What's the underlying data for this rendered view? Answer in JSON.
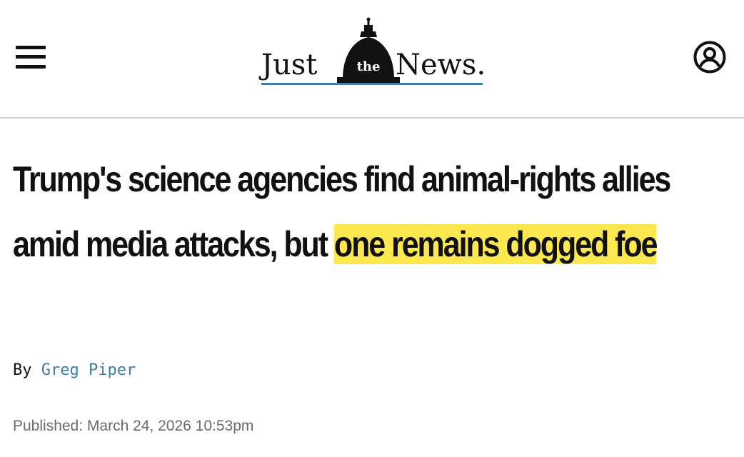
{
  "header": {
    "logo": {
      "word_left": "Just",
      "word_middle": "the",
      "word_right": "News.",
      "underline_color": "#3f7ea8"
    },
    "menu_icon": "hamburger-menu-icon",
    "account_icon": "user-circle-icon"
  },
  "article": {
    "headline_plain": "Trump's science agencies find animal-rights allies amid media attacks, but ",
    "headline_highlight": "one remains dogged foe",
    "highlight_color": "#fde84f",
    "byline_prefix": "By",
    "author": "Greg Piper",
    "author_color": "#3f7ea8",
    "published": "Published: March 24, 2026 10:53pm"
  }
}
